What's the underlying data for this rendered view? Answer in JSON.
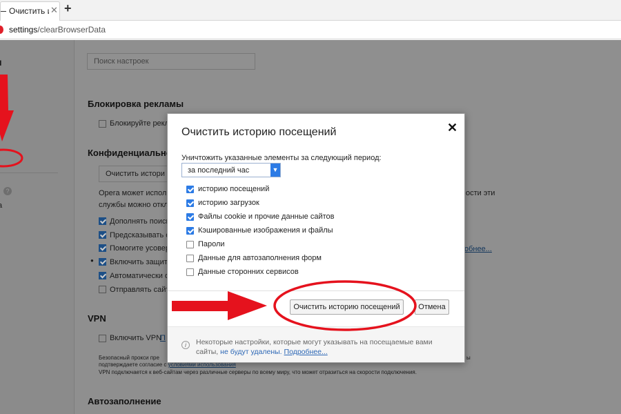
{
  "tab": {
    "title": "Очистить и",
    "close": "✕"
  },
  "newtab": "+",
  "address": {
    "host": "settings",
    "path": "/clearBrowserData"
  },
  "sidebar": {
    "heading": "и",
    "help": "?",
    "item": "а"
  },
  "settings": {
    "search_placeholder": "Поиск настроек",
    "ads": {
      "title": "Блокировка рекламы",
      "option": "Блокируйте рекл"
    },
    "privacy": {
      "title": "Конфиденциальнос",
      "clear_button": "Очистить истори",
      "desc_line1": "Opera может испол",
      "desc_line1_tail": "ости эти",
      "desc_line2": "службы можно откл",
      "options": [
        {
          "label": "Дополнять поиск",
          "checked": true
        },
        {
          "label": "Предсказывать с",
          "checked": true
        },
        {
          "label": "Помогите усовер",
          "checked": true
        },
        {
          "label": "Включить защиту",
          "checked": true
        },
        {
          "label": "Автоматически о",
          "checked": true
        },
        {
          "label": "Отправлять сайт",
          "checked": false
        }
      ],
      "more_link": "обнее..."
    },
    "vpn": {
      "title": "VPN",
      "option": "Включить VPN",
      "option_link": "П",
      "note1": "Безопасный прокси пре",
      "note1_tail": "ы",
      "note2": "подтверждаете согласие с",
      "note2_link": "условиями использования",
      "note3": "VPN подключается к веб-сайтам через различные серверы по всему миру, что может отразиться на скорости подключения."
    },
    "autofill": {
      "title": "Автозаполнение"
    }
  },
  "modal": {
    "title": "Очистить историю посещений",
    "close": "✕",
    "period_label": "Уничтожить указанные элементы за следующий период:",
    "period_value": "за последний час",
    "items": [
      {
        "label": "историю посещений",
        "checked": true
      },
      {
        "label": "историю загрузок",
        "checked": true
      },
      {
        "label": "Файлы cookie и прочие данные сайтов",
        "checked": true
      },
      {
        "label": "Кэшированные изображения и файлы",
        "checked": true
      },
      {
        "label": "Пароли",
        "checked": false
      },
      {
        "label": "Данные для автозаполнения форм",
        "checked": false
      },
      {
        "label": "Данные сторонних сервисов",
        "checked": false
      }
    ],
    "clear_button": "Очистить историю посещений",
    "cancel_button": "Отмена",
    "footer_text": "Некоторые настройки, которые могут указывать на посещаемые вами сайты,",
    "footer_em": "не будут удалены.",
    "footer_link": "Подробнее..."
  },
  "colors": {
    "annotation_red": "#e5121d",
    "accent": "#2c7be5"
  }
}
